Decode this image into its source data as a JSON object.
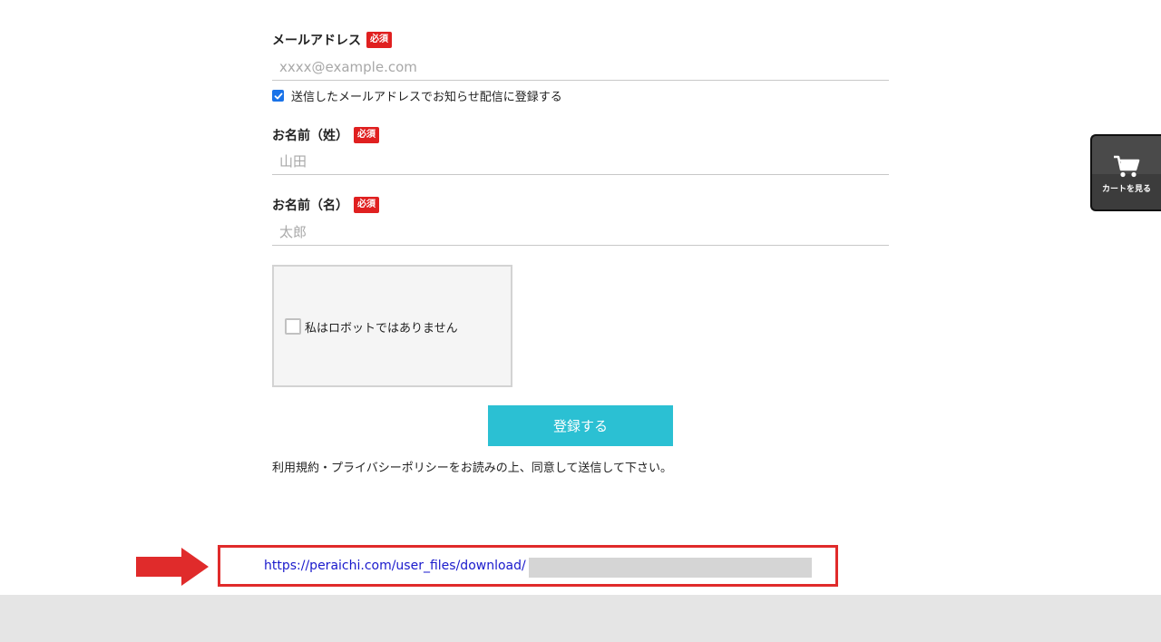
{
  "form": {
    "email": {
      "label": "メールアドレス",
      "required_badge": "必須",
      "placeholder": "xxxx@example.com",
      "value": ""
    },
    "optin": {
      "checked": true,
      "label": "送信したメールアドレスでお知らせ配信に登録する"
    },
    "last_name": {
      "label": "お名前（姓）",
      "required_badge": "必須",
      "placeholder": "山田",
      "value": ""
    },
    "first_name": {
      "label": "お名前（名）",
      "required_badge": "必須",
      "placeholder": "太郎",
      "value": ""
    },
    "recaptcha": {
      "label": "私はロボットではありません",
      "checked": false
    },
    "submit_label": "登録する",
    "terms_text": "利用規約・プライバシーポリシーをお読みの上、同意して送信して下さい。"
  },
  "download": {
    "url_text": "https://peraichi.com/user_files/download/",
    "redacted": true
  },
  "cart": {
    "label": "カートを見る",
    "icon": "cart-icon"
  },
  "colors": {
    "accent_button": "#2bc0d3",
    "required_badge": "#e02020",
    "highlight_box": "#e02b2b",
    "link": "#1a1acc",
    "cart_bg": "#3c3c3c",
    "footer_band": "#e5e5e5"
  }
}
